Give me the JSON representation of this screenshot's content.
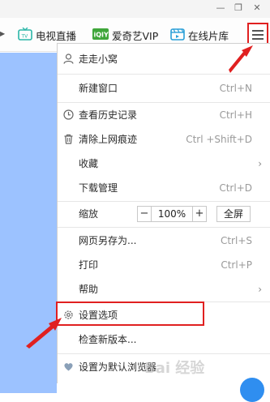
{
  "titlebar": {
    "minimize": "—",
    "restore": "❐",
    "close": "✕"
  },
  "toolbar": {
    "arrow": "▶",
    "bookmarks": [
      {
        "label": "电视直播",
        "icon": "tv-icon"
      },
      {
        "label": "爱奇艺VIP",
        "icon": "iqiyi-icon"
      },
      {
        "label": "在线片库",
        "icon": "film-icon"
      }
    ]
  },
  "menu": {
    "user": "走走小窝",
    "new_window": {
      "label": "新建窗口",
      "shortcut": "Ctrl+N"
    },
    "history": {
      "label": "查看历史记录",
      "shortcut": "Ctrl+H"
    },
    "clear": {
      "label": "清除上网痕迹",
      "shortcut": "Ctrl +Shift+D"
    },
    "favorites": {
      "label": "收藏"
    },
    "downloads": {
      "label": "下载管理",
      "shortcut": "Ctrl+D"
    },
    "zoom": {
      "label": "缩放",
      "minus": "−",
      "value": "100%",
      "plus": "+",
      "fullscreen": "全屏"
    },
    "save_as": {
      "label": "网页另存为...",
      "shortcut": "Ctrl+S"
    },
    "print": {
      "label": "打印",
      "shortcut": "Ctrl+P"
    },
    "help": {
      "label": "帮助"
    },
    "settings": {
      "label": "设置选项"
    },
    "check_update": {
      "label": "检查新版本..."
    },
    "default_browser": {
      "label": "设置为默认浏览器"
    }
  },
  "watermark": "Bai 经验",
  "colors": {
    "highlight": "#e02020",
    "pane": "#9cc2ff"
  }
}
